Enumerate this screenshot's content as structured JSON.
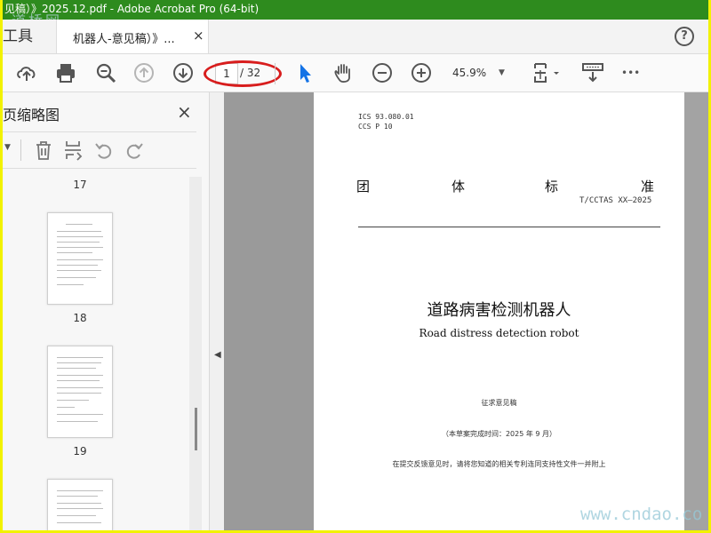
{
  "window": {
    "title": "见稿）》2025.12.pdf - Adobe Acrobat Pro (64-bit)",
    "watermark_top": "道桥网",
    "watermark_bottom": "www.cndao.co"
  },
  "tabs": {
    "tools_label": "工具",
    "doc_label": "机器人-意见稿）》...",
    "close_glyph": "×",
    "help_glyph": "?"
  },
  "toolbar": {
    "current_page": "1",
    "total_pages": "/ 32",
    "zoom": "45.9%",
    "more_glyph": "•••"
  },
  "thumbnails_pane": {
    "title": "页缩略图",
    "close_glyph": "×",
    "page_numbers": [
      "17",
      "18",
      "19"
    ]
  },
  "document": {
    "ics": "ICS  93.080.01",
    "ccs": "CCS  P 10",
    "standard_chars": [
      "团",
      "体",
      "标",
      "准"
    ],
    "standard_no": "T/CCTAS XX—2025",
    "title_cn": "道路病害检测机器人",
    "title_en": "Road distress detection robot",
    "draft_label": "征求意见稿",
    "draft_date": "（本草案完成时间：2025 年 9 月）",
    "feedback_note": "在提交反馈意见时，请将您知道的相关专利连同支持性文件一并附上"
  },
  "colors": {
    "titlebar": "#2e8b1e",
    "frame": "#f2f200",
    "highlight_ellipse": "#d81d1d",
    "cursor_blue": "#1473e6"
  }
}
